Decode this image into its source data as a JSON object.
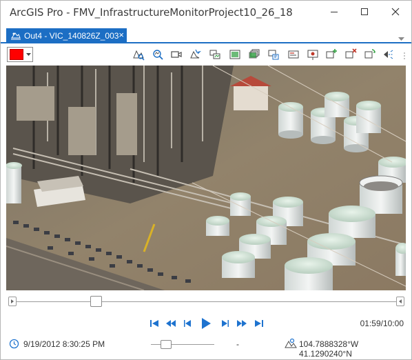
{
  "window": {
    "title": "ArcGIS Pro - FMV_InfrastructureMonitorProject10_26_18",
    "minimize_icon": "minimize-icon",
    "maximize_icon": "maximize-icon",
    "close_icon": "close-icon"
  },
  "tab": {
    "label": "Out4 - VIC_140826Z_003",
    "close_glyph": "×",
    "icon": "video-tab-icon"
  },
  "toolbar": {
    "color": "#ff0000",
    "tools": [
      "zoom-to-footprint-icon",
      "zoom-to-frame-icon",
      "camera-icon",
      "follow-platform-icon",
      "capture-frame-icon",
      "export-frame-icon",
      "export-multiple-frames-icon",
      "bookmark-icon",
      "metadata-icon",
      "add-marker-icon",
      "add-feature-icon",
      "delete-feature-icon",
      "sync-icon",
      "measure-icon"
    ]
  },
  "video": {
    "description_icon": "video-frame"
  },
  "timeline": {
    "position": 0.2
  },
  "playback": {
    "time": "01:59/10:00",
    "buttons": [
      "skip-to-start-icon",
      "rewind-icon",
      "step-back-icon",
      "play-icon",
      "step-forward-icon",
      "fast-forward-icon",
      "skip-to-end-icon"
    ]
  },
  "status": {
    "date": "9/19/2012 8:30:25 PM",
    "speed_value": "-",
    "coordinates": "104.7888328°W 41.1290240°N"
  },
  "colors": {
    "accent": "#1c6ec4",
    "playback": "#1e73cf"
  }
}
